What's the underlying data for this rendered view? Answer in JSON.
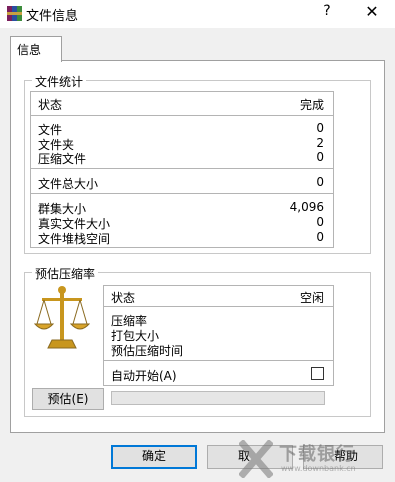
{
  "window": {
    "title": "文件信息",
    "help": "?",
    "close": "✕"
  },
  "tab": {
    "label": "信息"
  },
  "stats": {
    "title": "文件统计",
    "status_label": "状态",
    "status_value": "完成",
    "files_label": "文件",
    "files_value": "0",
    "folders_label": "文件夹",
    "folders_value": "2",
    "archives_label": "压缩文件",
    "archives_value": "0",
    "total_label": "文件总大小",
    "total_value": "0",
    "cluster_label": "群集大小",
    "cluster_value": "4,096",
    "real_label": "真实文件大小",
    "real_value": "0",
    "stack_label": "文件堆栈空间",
    "stack_value": "0"
  },
  "estimate": {
    "title": "预估压缩率",
    "status_label": "状态",
    "status_value": "空闲",
    "ratio_label": "压缩率",
    "pack_label": "打包大小",
    "time_label": "预估压缩时间",
    "auto_start_label": "自动开始(A)",
    "auto_start_checked": false,
    "estimate_button": "预估(E)",
    "progress": 0
  },
  "buttons": {
    "ok": "确定",
    "cancel": "取",
    "help": "帮助"
  },
  "watermark": {
    "brand": "下载银行",
    "url": "www.downbank.cn"
  },
  "colors": {
    "accent": "#0078d7",
    "scale_gold": "#c8961e"
  }
}
